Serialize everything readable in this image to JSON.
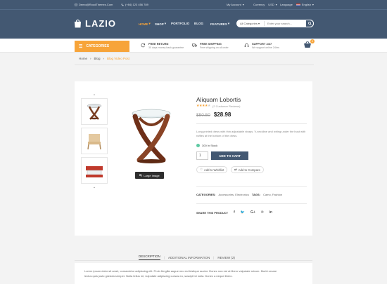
{
  "topbar": {
    "email": "Demo@RoodThemes.Com",
    "phone": "(+84) 123 456 789",
    "account": "My Account",
    "currency": "Currency",
    "currency_value": "USD",
    "language": "Language",
    "language_value": "English"
  },
  "logo": "LAZIO",
  "nav": [
    {
      "label": "HOME",
      "active": true,
      "dropdown": true
    },
    {
      "label": "SHOP",
      "active": false,
      "dropdown": true
    },
    {
      "label": "PORTFOLIO",
      "active": false,
      "dropdown": false
    },
    {
      "label": "BLOG",
      "active": false,
      "dropdown": false
    },
    {
      "label": "FEATURES",
      "active": false,
      "dropdown": true
    }
  ],
  "search": {
    "category": "All Categories",
    "placeholder": "Enter your search..."
  },
  "categories_label": "CATEGORIES",
  "features": [
    {
      "title": "FREE RETURN",
      "sub": "30 days money back guarantee",
      "icon": "refresh-icon"
    },
    {
      "title": "FREE SHIPPING",
      "sub": "Free shipping on all order",
      "icon": "truck-icon"
    },
    {
      "title": "SUPPORT 24/7",
      "sub": "We support online 24hrs",
      "icon": "support-icon"
    }
  ],
  "cart_count": "0",
  "breadcrumb": {
    "home": "Home",
    "blog": "Blog",
    "current": "Blog Video Post"
  },
  "product": {
    "title": "Aliquam Lobortis",
    "reviews": "(2 Customer Reviews)",
    "rating": 4,
    "old_price": "$50.50",
    "new_price": "$28.98",
    "description": "Long printed dress with thin adjustable straps. V-neckline and wiring under the bust with ruffles at the bottom of the dress.",
    "stock": "300 In Stock",
    "quantity": "1",
    "add_to_cart": "ADD TO CART",
    "wishlist": "Add to Wishlist",
    "compare": "Add to Compare",
    "categories_label": "CATEGORIES:",
    "categories_value": "Accessories, Electronics",
    "tags_label": "TAGS:",
    "tags_value": "Camo, Fashion",
    "share_label": "SHARE THIS PRODUCT",
    "enlarge": "Large Image"
  },
  "tabs": [
    {
      "label": "DESCRIPTION",
      "active": true
    },
    {
      "label": "ADDITIONAL INFORMATION",
      "active": false
    },
    {
      "label": "REVIEW (2)",
      "active": false
    }
  ],
  "desc_line1": "Lorem ipsum dolor sit amet, consectetur adipiscing elit. Proin fringilla augue nec est tristique auctor. Donec non est at libero vulputate rutrum. Morbi ornare",
  "desc_line2": "lectus quis justo gravida semper. Nulla tellus mi, vulputate adipiscing cursus eu, suscipit id nulla. Donec a neque libero.",
  "colors": {
    "header": "#435872",
    "accent": "#f7a439"
  }
}
